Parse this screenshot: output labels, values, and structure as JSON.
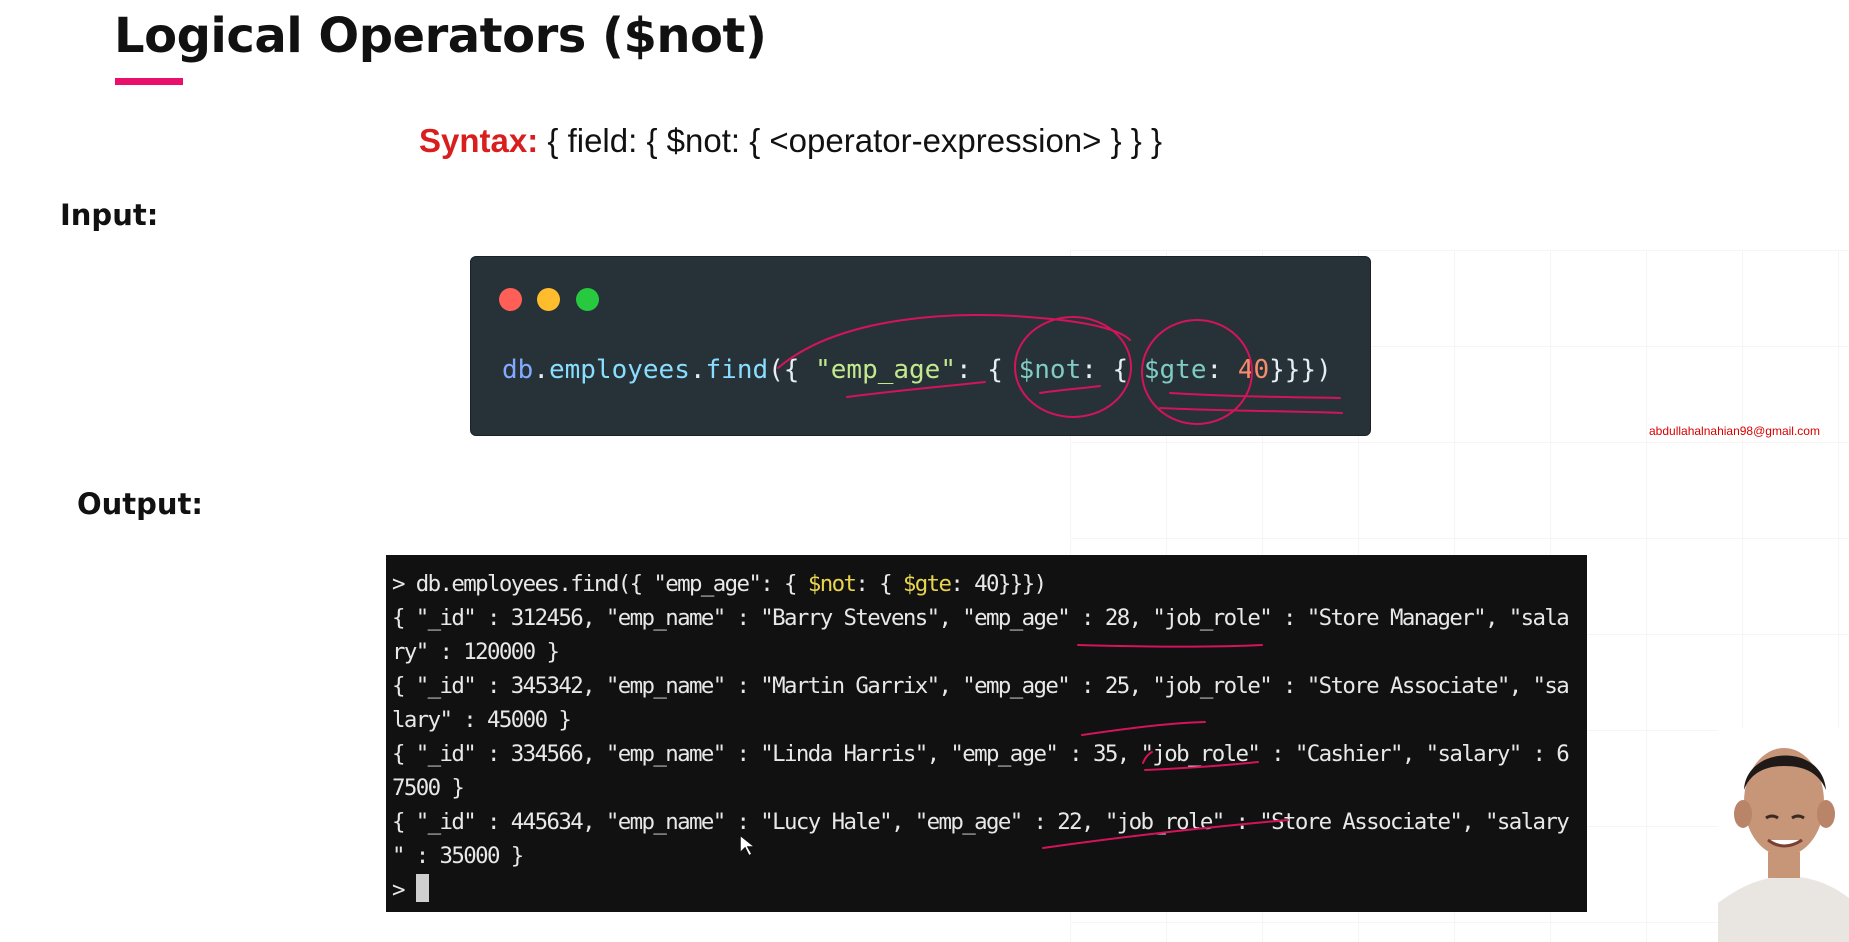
{
  "slide": {
    "title": "Logical Operators ($not)",
    "syntax_label": "Syntax:",
    "syntax_rest": " { field: { $not: { <operator-expression> } } }",
    "input_label": "Input:",
    "output_label": "Output:"
  },
  "code_window": {
    "tokens": {
      "db": "db",
      "dot1": ".",
      "employees": "employees",
      "dot2": ".",
      "find": "find",
      "open": "({ ",
      "key": "\"emp_age\"",
      "colon1": ": { ",
      "not_op": "$not",
      "colon2": ": { ",
      "gte_op": "$gte",
      "colon3": ": ",
      "value": "40",
      "close": "}}})"
    }
  },
  "watermark": {
    "email": "abdullahalnahian98@gmail.com"
  },
  "terminal": {
    "command_prefix": "> db.employees.find({ \"emp_age\": { ",
    "command_not": "$not",
    "command_mid": ": { ",
    "command_gte": "$gte",
    "command_suffix": ": 40}}})",
    "result_lines": [
      "{ \"_id\" : 312456, \"emp_name\" : \"Barry Stevens\", \"emp_age\" : 28, \"job_role\" : \"Store Manager\", \"sala",
      "ry\" : 120000 }",
      "{ \"_id\" : 345342, \"emp_name\" : \"Martin Garrix\", \"emp_age\" : 25, \"job_role\" : \"Store Associate\", \"sa",
      "lary\" : 45000 }",
      "{ \"_id\" : 334566, \"emp_name\" : \"Linda Harris\", \"emp_age\" : 35, \"job_role\" : \"Cashier\", \"salary\" : 6",
      "7500 }",
      "{ \"_id\" : 445634, \"emp_name\" : \"Lucy Hale\", \"emp_age\" : 22, \"job_role\" : \"Store Associate\", \"salary",
      "\" : 35000 }"
    ],
    "prompt": "> "
  },
  "colors": {
    "accent_underline": "#e8106a",
    "syntax_red": "#d91e1e",
    "code_background": "#263238",
    "terminal_background": "#111111",
    "terminal_highlight": "#e8d44d",
    "ink_annotation": "#d4145a",
    "watermark_red": "#d80000"
  },
  "icons": {
    "window_controls": [
      "red-close-dot-icon",
      "yellow-minimize-dot-icon",
      "green-maximize-dot-icon"
    ],
    "pointer": "mouse-pointer-icon"
  }
}
